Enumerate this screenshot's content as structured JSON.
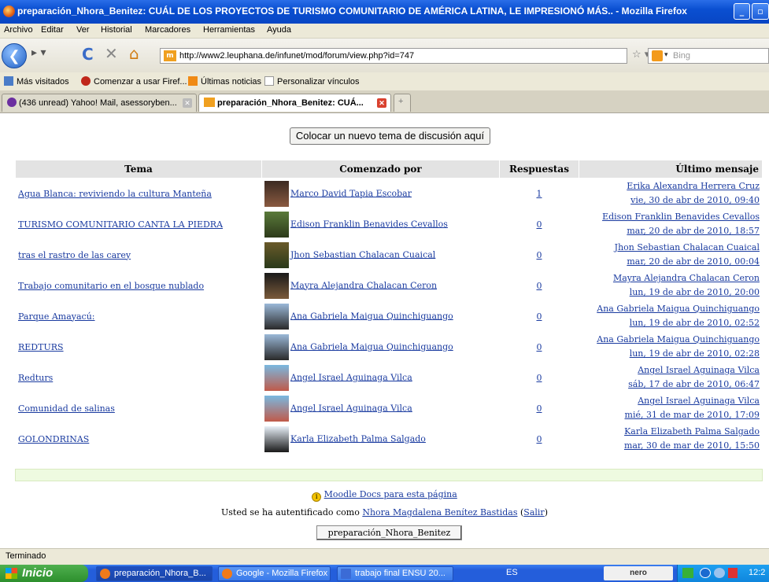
{
  "window": {
    "title": "preparación_Nhora_Benitez: CUÁL DE LOS PROYECTOS DE TURISMO COMUNITARIO DE AMÉRICA LATINA, LE IMPRESIONÓ MÁS.. - Mozilla Firefox"
  },
  "menu": [
    "Archivo",
    "Editar",
    "Ver",
    "Historial",
    "Marcadores",
    "Herramientas",
    "Ayuda"
  ],
  "nav": {
    "url": "http://www2.leuphana.de/infunet/mod/forum/view.php?id=747",
    "search_placeholder": "Bing"
  },
  "bookmarks": [
    "Más visitados",
    "Comenzar a usar Firef...",
    "Últimas noticias",
    "Personalizar vínculos"
  ],
  "tabs": [
    {
      "label": "(436 unread) Yahoo! Mail, asessoryben..."
    },
    {
      "label": "preparación_Nhora_Benitez: CUÁ..."
    }
  ],
  "forum": {
    "new_topic_button": "Colocar un nuevo tema de discusión aquí",
    "headers": {
      "topic": "Tema",
      "started_by": "Comenzado por",
      "replies": "Respuestas",
      "last_post": "Último mensaje"
    },
    "rows": [
      {
        "topic": "Agua Blanca: reviviendo la cultura Manteña",
        "author": "Marco David Tapia Escobar",
        "replies": "1",
        "last_author": "Erika Alexandra Herrera Cruz",
        "last_date": "vie, 30 de abr de 2010, 09:40"
      },
      {
        "topic": "TURISMO COMUNITARIO CANTA LA PIEDRA",
        "author": "Edison Franklin Benavides Cevallos",
        "replies": "0",
        "last_author": "Edison Franklin Benavides Cevallos",
        "last_date": "mar, 20 de abr de 2010, 18:57"
      },
      {
        "topic": "tras el rastro de las carey",
        "author": "Jhon Sebastian Chalacan Cuaical",
        "replies": "0",
        "last_author": "Jhon Sebastian Chalacan Cuaical",
        "last_date": "mar, 20 de abr de 2010, 00:04"
      },
      {
        "topic": "Trabajo comunitario en el bosque nublado",
        "author": "Mayra Alejandra Chalacan Ceron",
        "replies": "0",
        "last_author": "Mayra Alejandra Chalacan Ceron",
        "last_date": "lun, 19 de abr de 2010, 20:00"
      },
      {
        "topic": "Parque Amayacú:",
        "author": "Ana Gabriela Maigua Quinchiguango",
        "replies": "0",
        "last_author": "Ana Gabriela Maigua Quinchiguango",
        "last_date": "lun, 19 de abr de 2010, 02:52"
      },
      {
        "topic": "REDTURS",
        "author": "Ana Gabriela Maigua Quinchiguango",
        "replies": "0",
        "last_author": "Ana Gabriela Maigua Quinchiguango",
        "last_date": "lun, 19 de abr de 2010, 02:28"
      },
      {
        "topic": "Redturs",
        "author": "Angel Israel Aguinaga Vilca",
        "replies": "0",
        "last_author": "Angel Israel Aguinaga Vilca",
        "last_date": "sáb, 17 de abr de 2010, 06:47"
      },
      {
        "topic": "Comunidad de salinas",
        "author": "Angel Israel Aguinaga Vilca",
        "replies": "0",
        "last_author": "Angel Israel Aguinaga Vilca",
        "last_date": "mié, 31 de mar de 2010, 17:09"
      },
      {
        "topic": "GOLONDRINAS",
        "author": "Karla Elizabeth Palma Salgado",
        "replies": "0",
        "last_author": "Karla Elizabeth Palma Salgado",
        "last_date": "mar, 30 de mar de 2010, 15:50"
      }
    ]
  },
  "footer": {
    "docs_link": "Moodle Docs para esta página",
    "logged_in_prefix": "Usted se ha autentificado como",
    "user_name": "Nhora Magdalena Benítez Bastidas",
    "logout": "Salir",
    "course_button": "preparación_Nhora_Benitez"
  },
  "status": "Terminado",
  "taskbar": {
    "start": "Inicio",
    "tasks": [
      "preparación_Nhora_B...",
      "Google - Mozilla Firefox",
      "trabajo final ENSU 20..."
    ],
    "lang": "ES",
    "nero": "nero",
    "clock": "12:2"
  }
}
